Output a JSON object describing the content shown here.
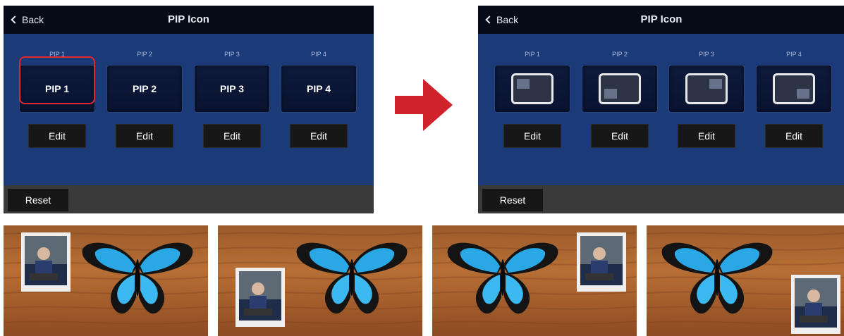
{
  "left_panel": {
    "back_label": "Back",
    "title": "PIP Icon",
    "slots": [
      {
        "label": "PIP 1",
        "button": "PIP 1",
        "edit": "Edit"
      },
      {
        "label": "PIP 2",
        "button": "PIP 2",
        "edit": "Edit"
      },
      {
        "label": "PIP 3",
        "button": "PIP 3",
        "edit": "Edit"
      },
      {
        "label": "PIP 4",
        "button": "PIP 4",
        "edit": "Edit"
      }
    ],
    "reset_label": "Reset"
  },
  "right_panel": {
    "back_label": "Back",
    "title": "PIP Icon",
    "slots": [
      {
        "label": "PIP 1",
        "icon": "pip-top-left-icon",
        "edit": "Edit"
      },
      {
        "label": "PIP 2",
        "icon": "pip-bottom-left-icon",
        "edit": "Edit"
      },
      {
        "label": "PIP 3",
        "icon": "pip-top-right-icon",
        "edit": "Edit"
      },
      {
        "label": "PIP 4",
        "icon": "pip-bottom-right-icon",
        "edit": "Edit"
      }
    ],
    "reset_label": "Reset"
  },
  "arrow_icon": "right-arrow-icon",
  "colors": {
    "panel": "#1a3a78",
    "titlebar": "#070b18",
    "highlight": "#e0282e",
    "arrow": "#d0222a"
  },
  "photos": [
    {
      "name": "photo-pip-top-left",
      "pip_position": "top-left"
    },
    {
      "name": "photo-pip-bottom-left",
      "pip_position": "bottom-left"
    },
    {
      "name": "photo-pip-top-right",
      "pip_position": "top-right"
    },
    {
      "name": "photo-pip-bottom-right",
      "pip_position": "bottom-right"
    }
  ]
}
